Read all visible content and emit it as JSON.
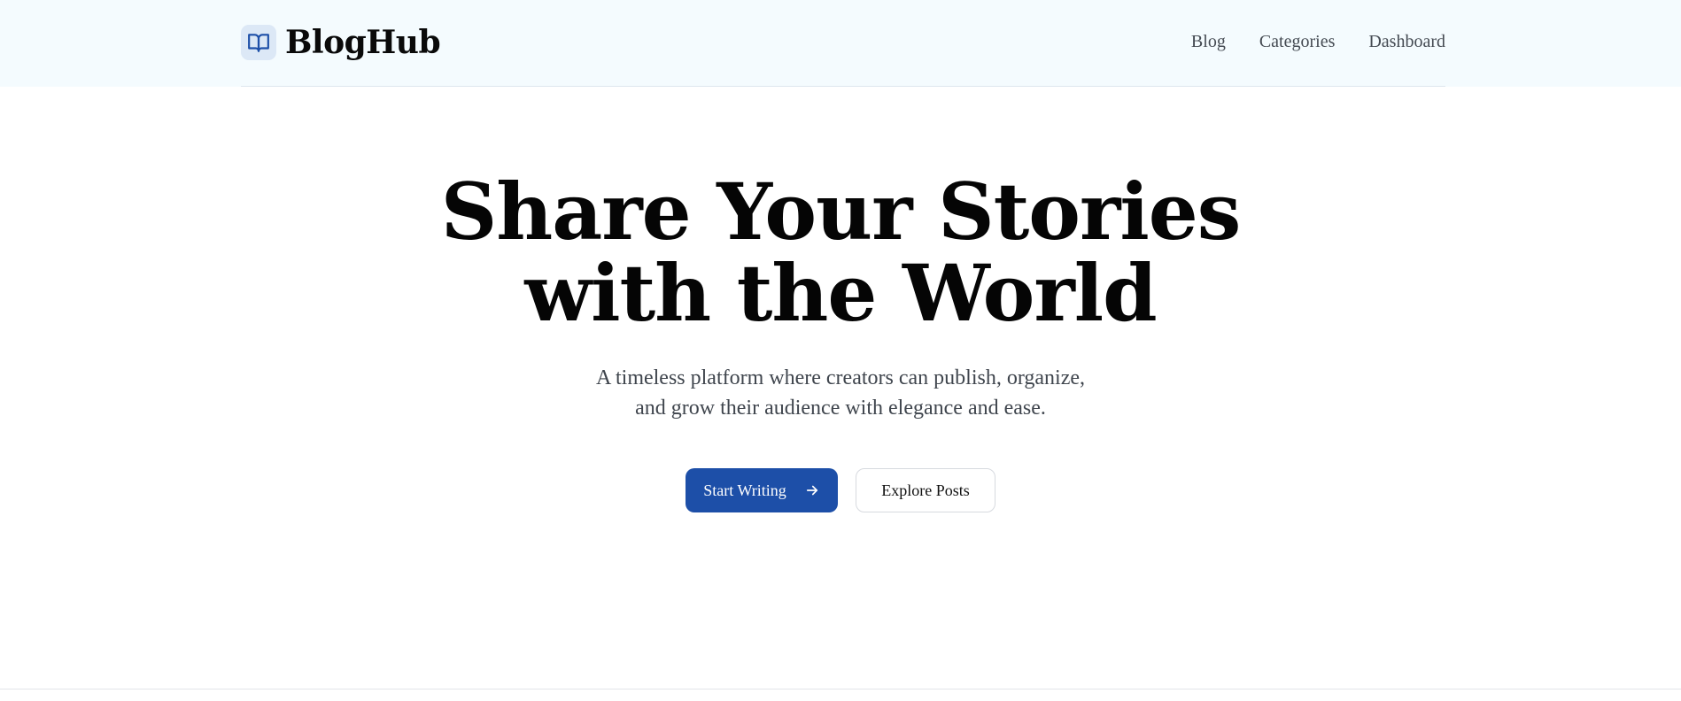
{
  "brand": {
    "name": "BlogHub",
    "icon": "open-book-icon"
  },
  "nav": {
    "links": [
      "Blog",
      "Categories",
      "Dashboard"
    ]
  },
  "hero": {
    "title_line1": "Share Your Stories",
    "title_line2": "with the World",
    "subtitle_line1": "A timeless platform where creators can publish, organize,",
    "subtitle_line2": "and grow their audience with elegance and ease."
  },
  "cta": {
    "primary_label": "Start Writing",
    "primary_icon": "arrow-right-icon",
    "secondary_label": "Explore Posts"
  },
  "colors": {
    "accent": "#1d4fa8",
    "header_bg": "#f4fbfe",
    "icon_bg": "#dce8f6",
    "text": "#0a0a0a",
    "muted_text": "#3f454d"
  }
}
